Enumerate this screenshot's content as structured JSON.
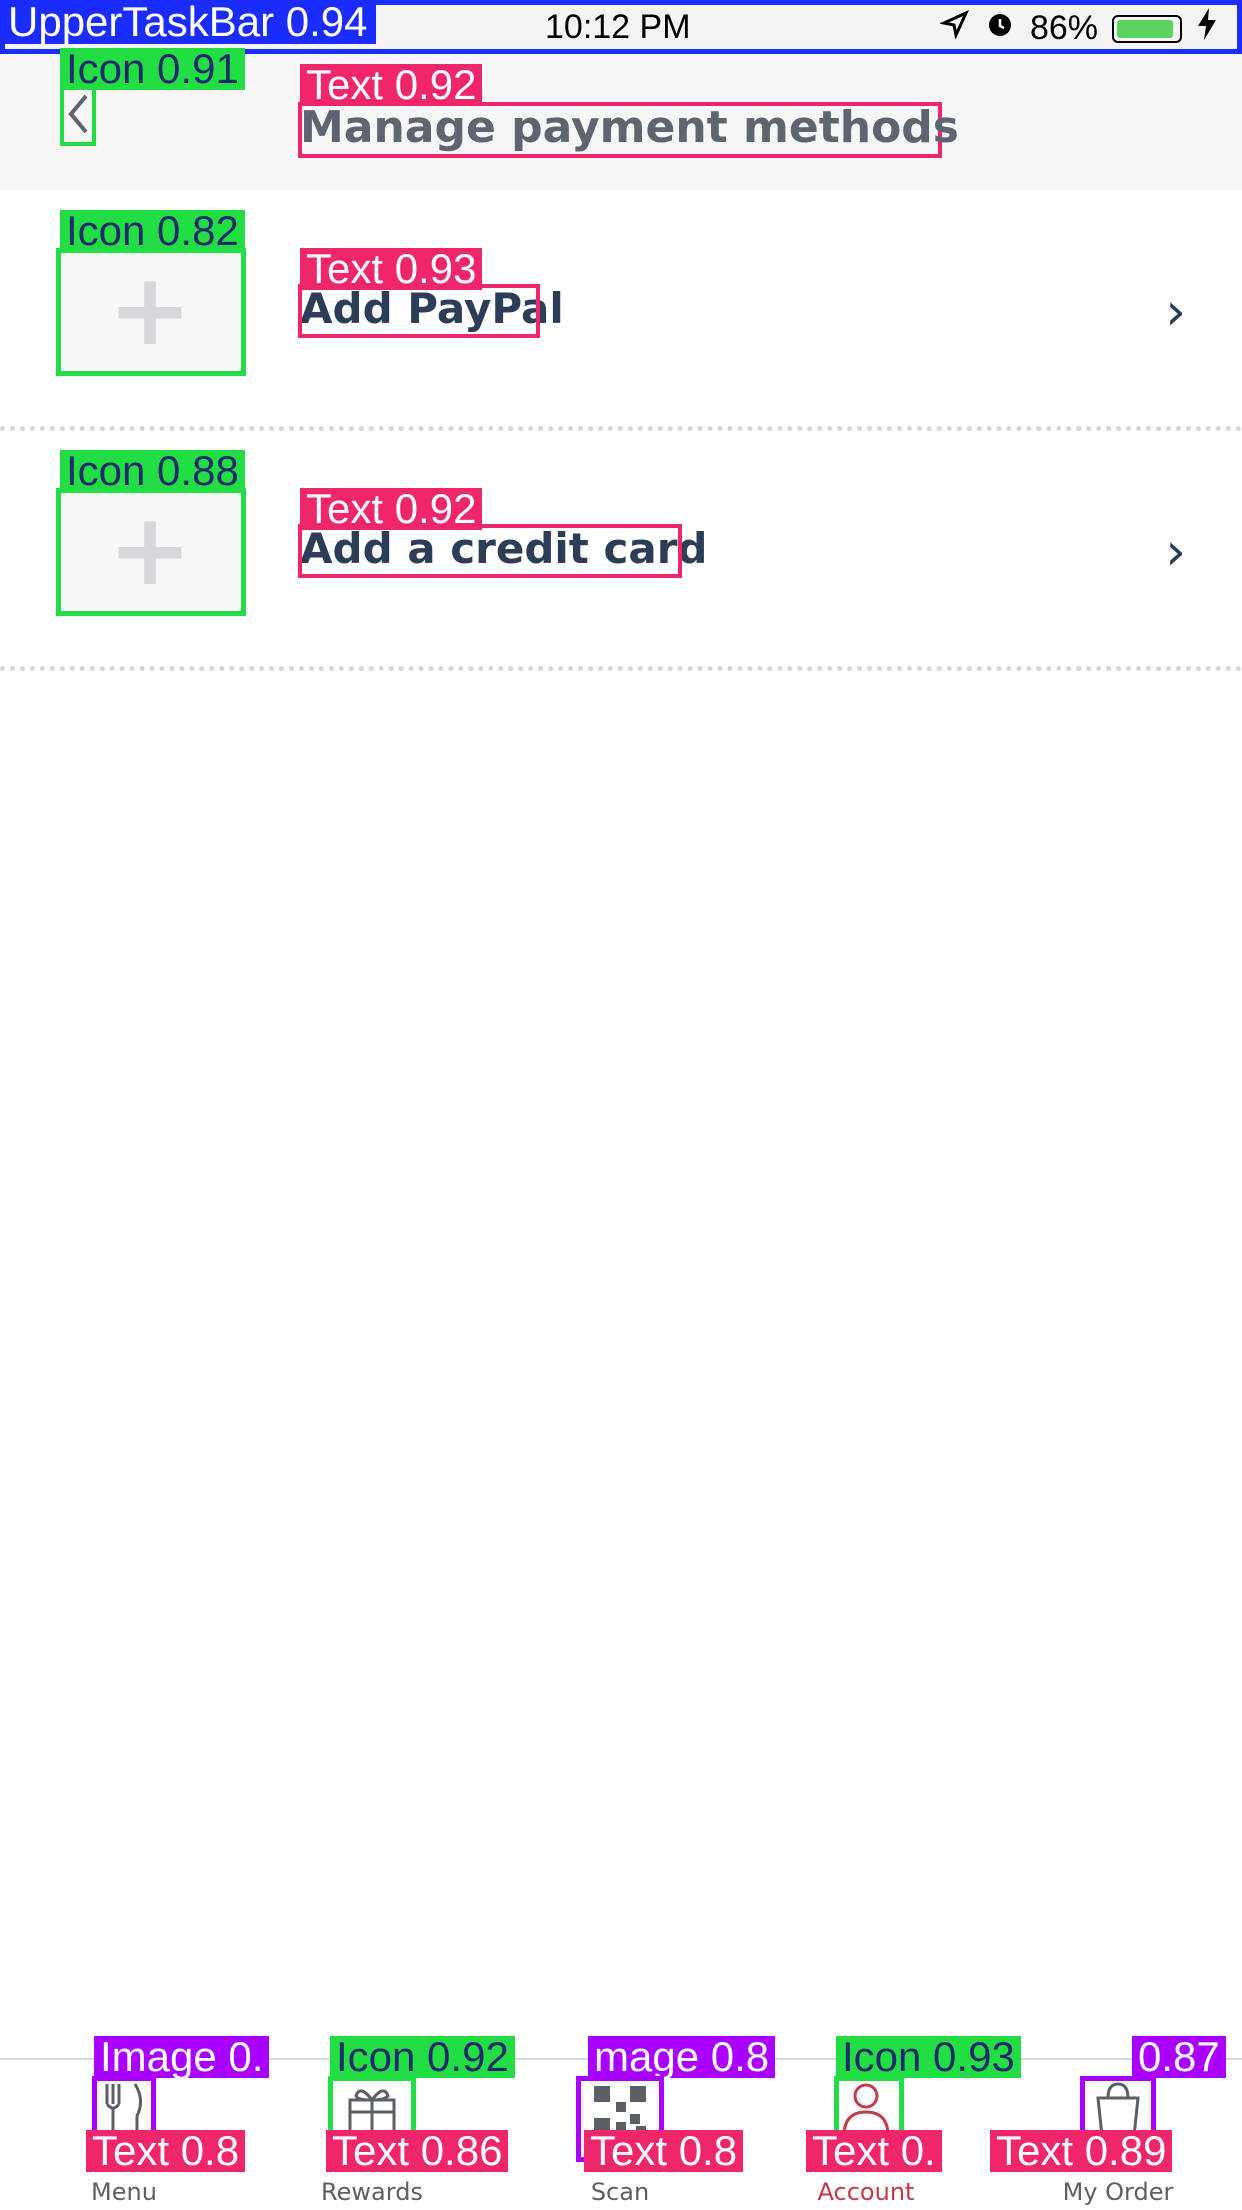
{
  "status": {
    "overlay_label": "UpperTaskBar 0.94",
    "time": "10:12 PM",
    "battery_pct": "86%"
  },
  "header": {
    "back_icon_tag": "Icon 0.91",
    "title_tag": "Text 0.92",
    "title": "Manage payment methods"
  },
  "rows": [
    {
      "icon_tag": "Icon 0.82",
      "label_tag": "Text 0.93",
      "label": "Add PayPal"
    },
    {
      "icon_tag": "Icon 0.88",
      "label_tag": "Text 0.92",
      "label": "Add a credit card"
    }
  ],
  "tabs": [
    {
      "label": "Menu",
      "icon_tag": "Image 0.",
      "label_tag": "Text 0.8",
      "icon": "fork-knife-icon"
    },
    {
      "label": "Rewards",
      "icon_tag": "Icon 0.92",
      "label_tag": "Text 0.86",
      "icon": "gift-icon"
    },
    {
      "label": "Scan",
      "icon_tag": "mage 0.8",
      "label_tag": "Text 0.8",
      "icon": "qr-code-icon"
    },
    {
      "label": "Account",
      "icon_tag": "Icon 0.93",
      "label_tag": "Text 0.",
      "icon": "person-icon"
    },
    {
      "label": "My Order",
      "icon_tag": "0.87",
      "label_tag": "Text 0.89",
      "icon": "bag-icon"
    }
  ],
  "colors": {
    "text_dark": "#2b3d57",
    "header_text": "#5e6570",
    "detect_green": "#22dd44",
    "detect_pink": "#f0266c",
    "detect_purple": "#aa00ff",
    "detect_blue": "#1a2cff",
    "battery_green": "#5fd35f"
  }
}
